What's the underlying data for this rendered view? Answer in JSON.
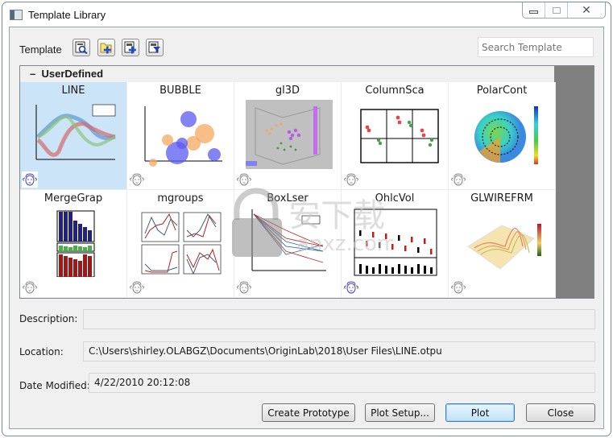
{
  "window": {
    "title": "Template Library",
    "controls": {
      "minimize": "minimize",
      "maximize": "maximize",
      "close": "close"
    }
  },
  "toolbar": {
    "label": "Template",
    "buttons": [
      {
        "name": "preview-template-icon",
        "tooltip": "Preview"
      },
      {
        "name": "add-folder-icon",
        "tooltip": "Add Folder"
      },
      {
        "name": "add-template-icon",
        "tooltip": "Add Template"
      },
      {
        "name": "filter-template-icon",
        "tooltip": "Filter"
      }
    ],
    "search_placeholder": "Search Template"
  },
  "gallery": {
    "group": {
      "toggle": "–",
      "name": "UserDefined"
    },
    "templates": [
      {
        "title": "LINE",
        "selected": true,
        "thumb": "line"
      },
      {
        "title": "BUBBLE",
        "selected": false,
        "thumb": "bubble"
      },
      {
        "title": "gl3D",
        "selected": false,
        "thumb": "gl3d"
      },
      {
        "title": "ColumnSca",
        "selected": false,
        "thumb": "columnsca"
      },
      {
        "title": "PolarCont",
        "selected": false,
        "thumb": "polar"
      },
      {
        "title": "MergeGrap",
        "selected": false,
        "thumb": "merge"
      },
      {
        "title": "mgroups",
        "selected": false,
        "thumb": "mgroups"
      },
      {
        "title": "BoxLser",
        "selected": false,
        "thumb": "boxlser"
      },
      {
        "title": "OhlcVol",
        "selected": false,
        "thumb": "ohlc"
      },
      {
        "title": "GLWIREFRM",
        "selected": false,
        "thumb": "wire"
      }
    ]
  },
  "details": {
    "description_label": "Description:",
    "description_value": "",
    "location_label": "Location:",
    "location_value": "C:\\Users\\shirley.OLABGZ\\Documents\\OriginLab\\2018\\User Files\\LINE.otpu",
    "date_label": "Date Modified:",
    "date_value": "4/22/2010 20:12:08"
  },
  "buttons": {
    "create_prototype": "Create Prototype",
    "plot_setup": "Plot Setup...",
    "plot": "Plot",
    "close": "Close"
  },
  "colors": {
    "selected_bg": "#cce4f7",
    "default_button": "#bfe2f7",
    "scroll_area": "#808080"
  }
}
